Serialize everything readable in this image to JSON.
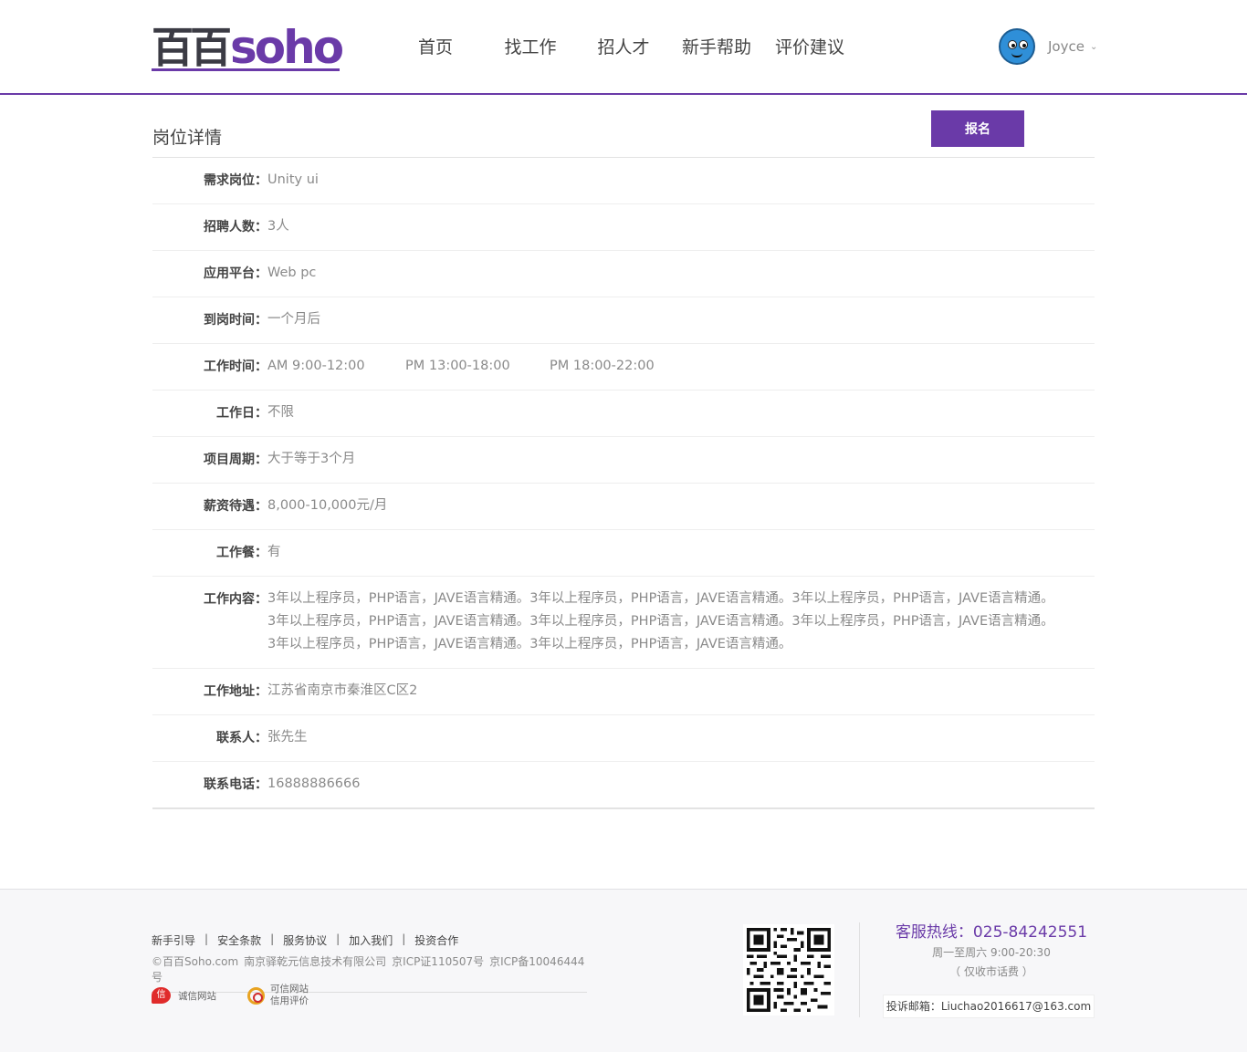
{
  "header": {
    "logo_cn": "百百",
    "logo_en": "soho",
    "nav": [
      "首页",
      "找工作",
      "招人才",
      "新手帮助",
      "评价建议"
    ],
    "user_name": "Joyce",
    "chevron": "⌄"
  },
  "detail": {
    "title": "岗位详情",
    "apply_label": "报名",
    "colon": "：",
    "rows": [
      {
        "label": "需求岗位",
        "value": "Unity ui"
      },
      {
        "label": "招聘人数",
        "value": "3人"
      },
      {
        "label": "应用平台",
        "value": "Web pc"
      },
      {
        "label": "到岗时间",
        "value": "一个月后"
      },
      {
        "label": "工作时间",
        "times": [
          "AM 9:00-12:00",
          "PM 13:00-18:00",
          "PM 18:00-22:00"
        ]
      },
      {
        "label": "工作日",
        "value": "不限"
      },
      {
        "label": "项目周期",
        "value": "大于等于3个月"
      },
      {
        "label": "薪资待遇",
        "value": "8,000-10,000元/月"
      },
      {
        "label": "工作餐",
        "value": "有"
      },
      {
        "label": "工作内容",
        "lines": [
          "3年以上程序员，PHP语言，JAVE语言精通。3年以上程序员，PHP语言，JAVE语言精通。3年以上程序员，PHP语言，JAVE语言精通。",
          "3年以上程序员，PHP语言，JAVE语言精通。3年以上程序员，PHP语言，JAVE语言精通。3年以上程序员，PHP语言，JAVE语言精通。",
          "3年以上程序员，PHP语言，JAVE语言精通。3年以上程序员，PHP语言，JAVE语言精通。"
        ]
      },
      {
        "label": "工作地址",
        "value": "江苏省南京市秦淮区C区2"
      },
      {
        "label": "联系人",
        "value": "张先生"
      },
      {
        "label": "联系电话",
        "value": "16888886666"
      }
    ]
  },
  "footer": {
    "links": [
      "新手引导",
      "安全条款",
      "服务协议",
      "加入我们",
      "投资合作"
    ],
    "separator": "|",
    "copyright": [
      "©百百Soho.com",
      "南京驿乾元信息技术有限公司",
      "京ICP证110507号",
      "京ICP备10046444号"
    ],
    "badge1_label": "诚信网站",
    "badge1_icon_text": "信",
    "badge2_line1": "可信网站",
    "badge2_line2": "信用评价",
    "hotline": "客服热线：025-84242551",
    "hours": "周一至周六 9:00-20:30",
    "note": "（ 仅收市话费 ）",
    "email": "投诉邮箱：Liuchao2016617@163.com"
  },
  "colors": {
    "accent": "#6a3aa8",
    "text_dark": "#444444",
    "text_muted": "#8a8a8a"
  },
  "icons": [
    "avatar-cartoon",
    "chevron-down-icon",
    "credit-badge-icon",
    "trust-badge-icon",
    "qr-code"
  ]
}
